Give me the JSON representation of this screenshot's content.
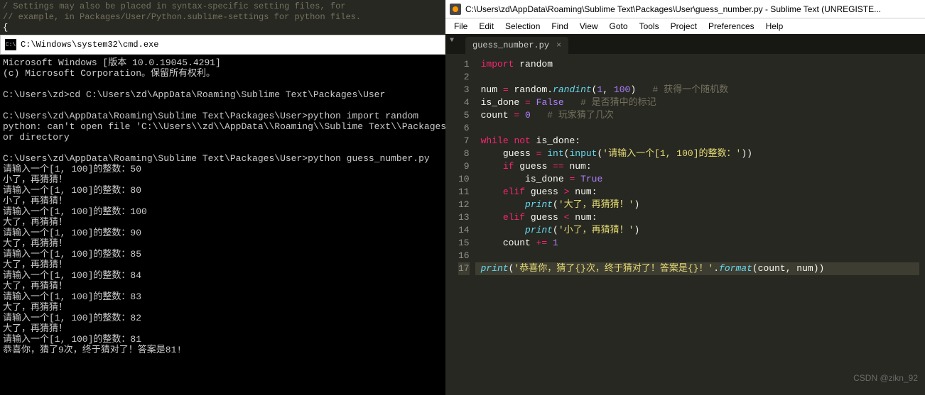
{
  "settings_hint": {
    "line1": "/ Settings may also be placed in syntax-specific setting files, for",
    "line2": "// example, in Packages/User/Python.sublime-settings for python files.",
    "brace": "{"
  },
  "cmd": {
    "title": "C:\\Windows\\system32\\cmd.exe",
    "icon_label": "cmd",
    "body": "Microsoft Windows [版本 10.0.19045.4291]\n(c) Microsoft Corporation。保留所有权利。\n\nC:\\Users\\zd>cd C:\\Users\\zd\\AppData\\Roaming\\Sublime Text\\Packages\\User\n\nC:\\Users\\zd\\AppData\\Roaming\\Sublime Text\\Packages\\User>python import random\npython: can't open file 'C:\\\\Users\\\\zd\\\\AppData\\\\Roaming\\\\Sublime Text\\\\Packages\nor directory\n\nC:\\Users\\zd\\AppData\\Roaming\\Sublime Text\\Packages\\User>python guess_number.py\n请输入一个[1, 100]的整数：50\n小了，再猜猜！\n请输入一个[1, 100]的整数：80\n小了，再猜猜！\n请输入一个[1, 100]的整数：100\n大了，再猜猜！\n请输入一个[1, 100]的整数：90\n大了，再猜猜！\n请输入一个[1, 100]的整数：85\n大了，再猜猜！\n请输入一个[1, 100]的整数：84\n大了，再猜猜！\n请输入一个[1, 100]的整数：83\n大了，再猜猜！\n请输入一个[1, 100]的整数：82\n大了，再猜猜！\n请输入一个[1, 100]的整数：81\n恭喜你，猜了9次，终于猜对了！答案是81!\n"
  },
  "sublime": {
    "title": "C:\\Users\\zd\\AppData\\Roaming\\Sublime Text\\Packages\\User\\guess_number.py - Sublime Text (UNREGISTE...",
    "menu": [
      "File",
      "Edit",
      "Selection",
      "Find",
      "View",
      "Goto",
      "Tools",
      "Project",
      "Preferences",
      "Help"
    ],
    "tab": {
      "label": "guess_number.py",
      "close": "×"
    },
    "caret": "▼",
    "line_count": 17,
    "code_tokens": [
      [
        [
          "kw",
          "import"
        ],
        [
          "id",
          " random"
        ]
      ],
      [],
      [
        [
          "id",
          "num "
        ],
        [
          "op",
          "="
        ],
        [
          "id",
          " random"
        ],
        [
          "pn",
          "."
        ],
        [
          "fn",
          "randint"
        ],
        [
          "pn",
          "("
        ],
        [
          "nm",
          "1"
        ],
        [
          "pn",
          ", "
        ],
        [
          "nm",
          "100"
        ],
        [
          "pn",
          ")   "
        ],
        [
          "cm",
          "# 获得一个随机数"
        ]
      ],
      [
        [
          "id",
          "is_done "
        ],
        [
          "op",
          "="
        ],
        [
          "id",
          " "
        ],
        [
          "nm",
          "False"
        ],
        [
          "id",
          "   "
        ],
        [
          "cm",
          "# 是否猜中的标记"
        ]
      ],
      [
        [
          "id",
          "count "
        ],
        [
          "op",
          "="
        ],
        [
          "id",
          " "
        ],
        [
          "nm",
          "0"
        ],
        [
          "id",
          "   "
        ],
        [
          "cm",
          "# 玩家猜了几次"
        ]
      ],
      [],
      [
        [
          "kw",
          "while"
        ],
        [
          "id",
          " "
        ],
        [
          "kw",
          "not"
        ],
        [
          "id",
          " is_done"
        ],
        [
          "pn",
          ":"
        ]
      ],
      [
        [
          "id",
          "    guess "
        ],
        [
          "op",
          "="
        ],
        [
          "id",
          " "
        ],
        [
          "bi",
          "int"
        ],
        [
          "pn",
          "("
        ],
        [
          "bi",
          "input"
        ],
        [
          "pn",
          "("
        ],
        [
          "str",
          "'请输入一个[1, 100]的整数：'"
        ],
        [
          "pn",
          "))"
        ]
      ],
      [
        [
          "id",
          "    "
        ],
        [
          "kw",
          "if"
        ],
        [
          "id",
          " guess "
        ],
        [
          "op",
          "=="
        ],
        [
          "id",
          " num"
        ],
        [
          "pn",
          ":"
        ]
      ],
      [
        [
          "id",
          "        is_done "
        ],
        [
          "op",
          "="
        ],
        [
          "id",
          " "
        ],
        [
          "nm",
          "True"
        ]
      ],
      [
        [
          "id",
          "    "
        ],
        [
          "kw",
          "elif"
        ],
        [
          "id",
          " guess "
        ],
        [
          "op",
          ">"
        ],
        [
          "id",
          " num"
        ],
        [
          "pn",
          ":"
        ]
      ],
      [
        [
          "id",
          "        "
        ],
        [
          "fn",
          "print"
        ],
        [
          "pn",
          "("
        ],
        [
          "str",
          "'大了，再猜猜！'"
        ],
        [
          "pn",
          ")"
        ]
      ],
      [
        [
          "id",
          "    "
        ],
        [
          "kw",
          "elif"
        ],
        [
          "id",
          " guess "
        ],
        [
          "op",
          "<"
        ],
        [
          "id",
          " num"
        ],
        [
          "pn",
          ":"
        ]
      ],
      [
        [
          "id",
          "        "
        ],
        [
          "fn",
          "print"
        ],
        [
          "pn",
          "("
        ],
        [
          "str",
          "'小了，再猜猜！'"
        ],
        [
          "pn",
          ")"
        ]
      ],
      [
        [
          "id",
          "    count "
        ],
        [
          "op",
          "+="
        ],
        [
          "id",
          " "
        ],
        [
          "nm",
          "1"
        ]
      ],
      [],
      [
        [
          "fn",
          "print"
        ],
        [
          "pn",
          "("
        ],
        [
          "str",
          "'恭喜你，猜了{}次，终于猜对了！答案是{}！'"
        ],
        [
          "pn",
          "."
        ],
        [
          "fn",
          "format"
        ],
        [
          "pn",
          "(count"
        ],
        [
          "pn",
          ", "
        ],
        [
          "pn",
          "num))"
        ]
      ]
    ],
    "highlight_line": 17
  },
  "watermark": "CSDN @zikn_92"
}
